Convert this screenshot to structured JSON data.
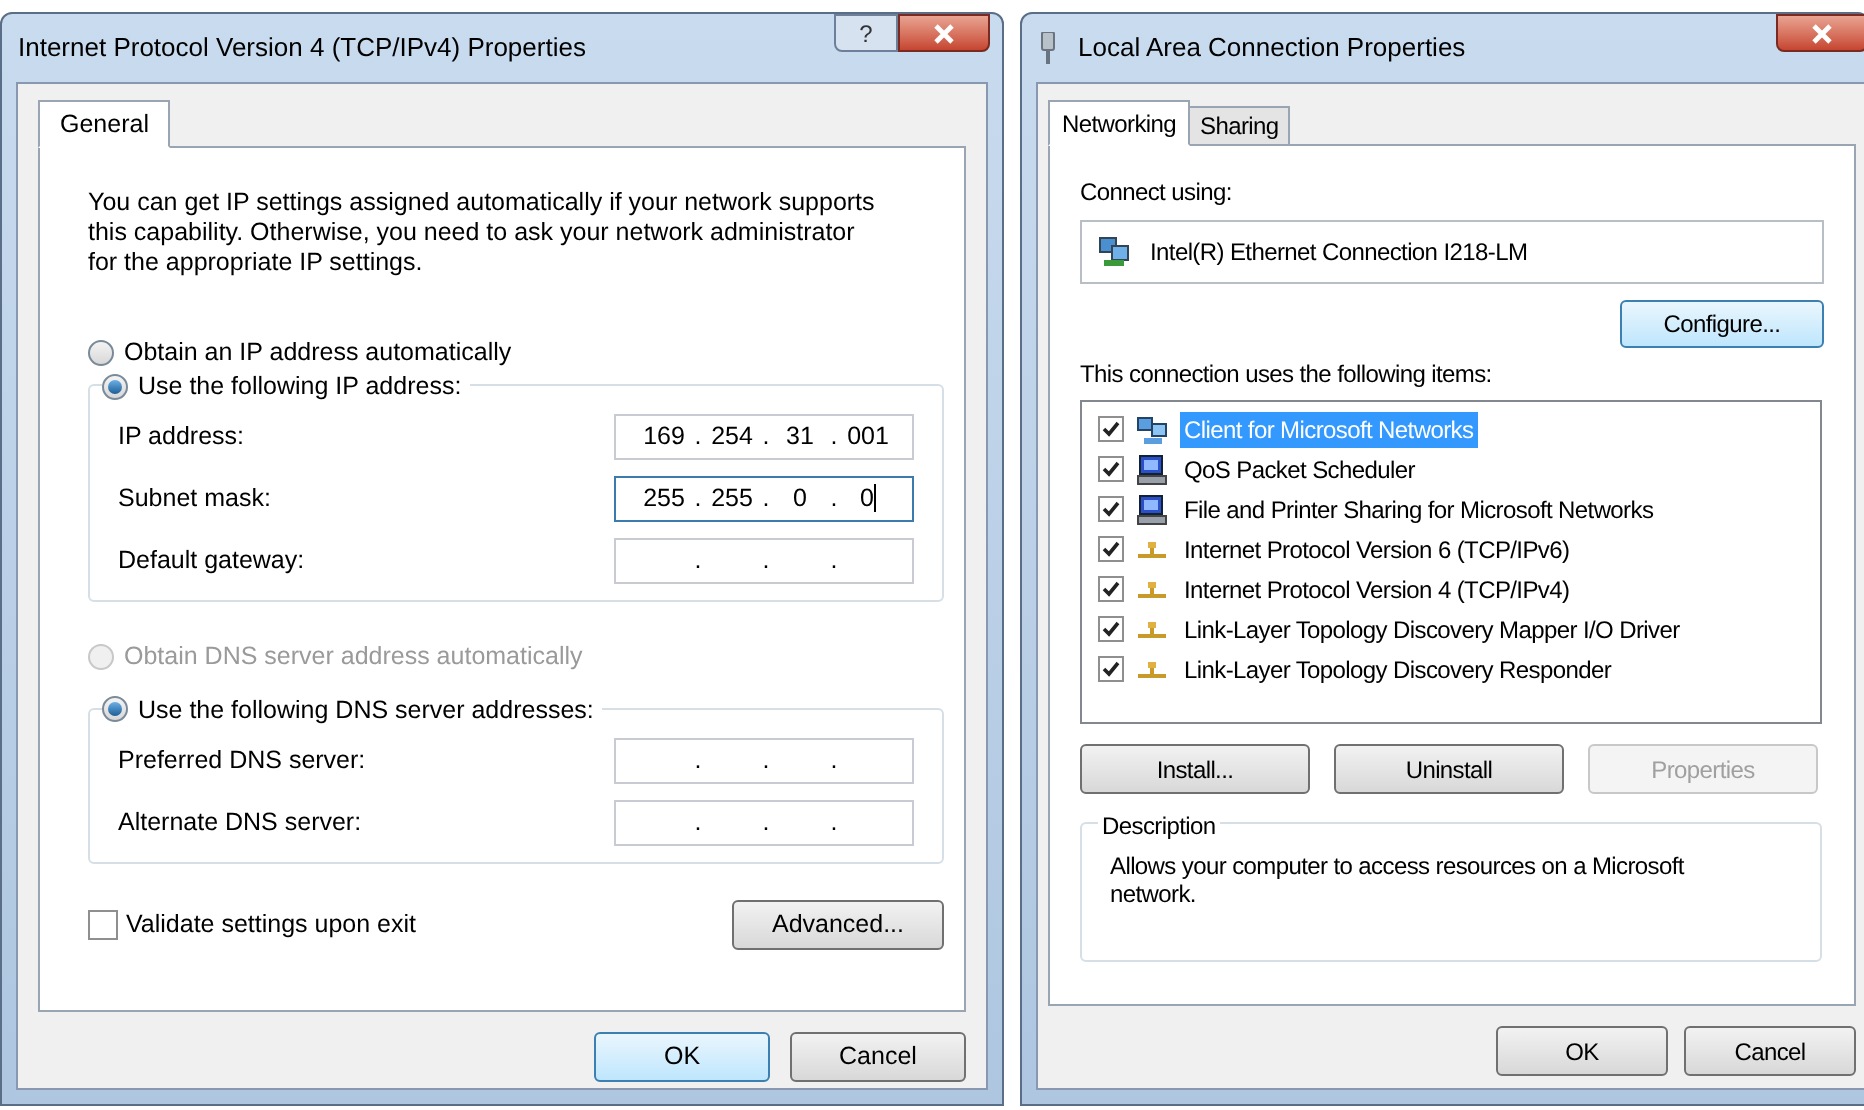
{
  "ipv4_dialog": {
    "title": "Internet Protocol Version 4 (TCP/IPv4) Properties",
    "help_button": "?",
    "tabs": [
      {
        "label": "General",
        "selected": true
      }
    ],
    "intro": "You can get IP settings assigned automatically if your network supports this capability. Otherwise, you need to ask your network administrator for the appropriate IP settings.",
    "ip_mode": [
      {
        "label": "Obtain an IP address automatically",
        "selected": false,
        "disabled": false
      },
      {
        "label": "Use the following IP address:",
        "selected": true,
        "disabled": false
      }
    ],
    "ip_fields": [
      {
        "label": "IP address:",
        "octets": [
          "169",
          "254",
          "31",
          "001"
        ],
        "separators": [
          ".",
          ".",
          "."
        ],
        "focused": false
      },
      {
        "label": "Subnet mask:",
        "octets": [
          "255",
          "255",
          "0",
          "0"
        ],
        "separators": [
          ".",
          ".",
          "."
        ],
        "focused": true
      },
      {
        "label": "Default gateway:",
        "separators": [
          ".",
          ".",
          "."
        ],
        "focused": false
      }
    ],
    "dns_mode": [
      {
        "label": "Obtain DNS server address automatically",
        "selected": false,
        "disabled": true
      },
      {
        "label": "Use the following DNS server addresses:",
        "selected": true,
        "disabled": false
      }
    ],
    "dns_fields": [
      {
        "label": "Preferred DNS server:",
        "separators": [
          ".",
          ".",
          "."
        ],
        "focused": false
      },
      {
        "label": "Alternate DNS server:",
        "separators": [
          ".",
          ".",
          "."
        ],
        "focused": false
      }
    ],
    "validate": {
      "label": "Validate settings upon exit",
      "checked": false
    },
    "advanced_button": "Advanced...",
    "buttons": [
      {
        "label": "OK",
        "default": true
      },
      {
        "label": "Cancel",
        "default": false
      }
    ]
  },
  "lan_dialog": {
    "title": "Local Area Connection Properties",
    "tabs": [
      {
        "label": "Networking",
        "selected": true
      },
      {
        "label": "Sharing",
        "selected": false
      }
    ],
    "connect_using_label": "Connect using:",
    "adapter": "Intel(R) Ethernet Connection I218-LM",
    "configure_button": "Configure...",
    "items_label": "This connection uses the following items:",
    "items": [
      {
        "label": "Client for Microsoft Networks",
        "kind": "client",
        "checked": true,
        "selected": true
      },
      {
        "label": "QoS Packet Scheduler",
        "kind": "service",
        "checked": true,
        "selected": false
      },
      {
        "label": "File and Printer Sharing for Microsoft Networks",
        "kind": "service",
        "checked": true,
        "selected": false
      },
      {
        "label": "Internet Protocol Version 6 (TCP/IPv6)",
        "kind": "protocol",
        "checked": true,
        "selected": false
      },
      {
        "label": "Internet Protocol Version 4 (TCP/IPv4)",
        "kind": "protocol",
        "checked": true,
        "selected": false
      },
      {
        "label": "Link-Layer Topology Discovery Mapper I/O Driver",
        "kind": "protocol",
        "checked": true,
        "selected": false
      },
      {
        "label": "Link-Layer Topology Discovery Responder",
        "kind": "protocol",
        "checked": true,
        "selected": false
      }
    ],
    "item_buttons": [
      {
        "label": "Install...",
        "disabled": false
      },
      {
        "label": "Uninstall",
        "disabled": false
      },
      {
        "label": "Properties",
        "disabled": true
      }
    ],
    "description_label": "Description",
    "description": "Allows your computer to access resources on a Microsoft network.",
    "buttons": [
      {
        "label": "OK",
        "default": false
      },
      {
        "label": "Cancel",
        "default": false
      }
    ]
  }
}
